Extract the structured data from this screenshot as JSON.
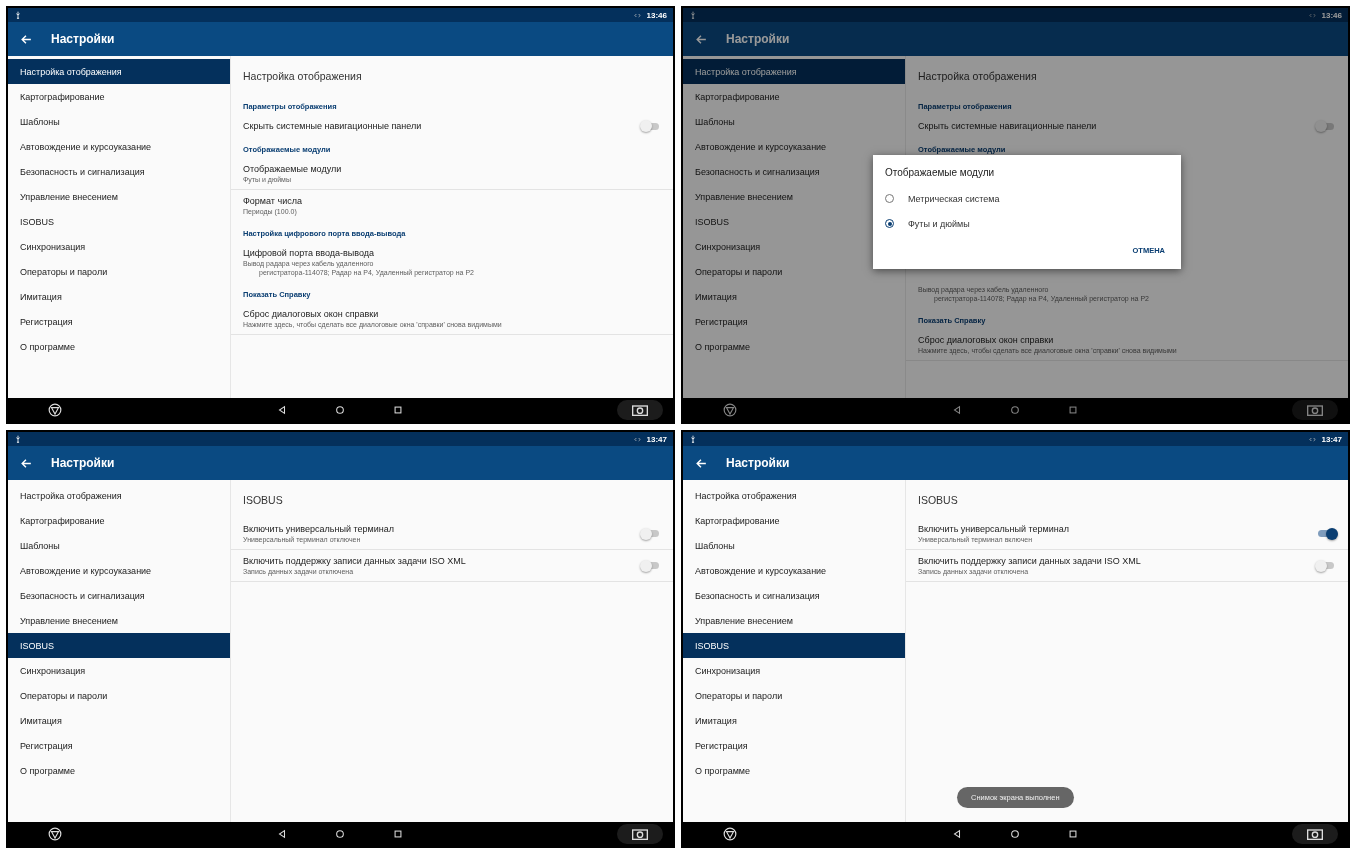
{
  "screens": [
    {
      "time": "13:46",
      "title": "Настройки",
      "sidebar": [
        {
          "label": "Настройка отображения",
          "selected": true
        },
        {
          "label": "Картографирование",
          "selected": false
        },
        {
          "label": "Шаблоны",
          "selected": false
        },
        {
          "label": "Автовождение и курсоуказание",
          "selected": false
        },
        {
          "label": "Безопасность и сигнализация",
          "selected": false
        },
        {
          "label": "Управление внесением",
          "selected": false
        },
        {
          "label": "ISOBUS",
          "selected": false
        },
        {
          "label": "Синхронизация",
          "selected": false
        },
        {
          "label": "Операторы и пароли",
          "selected": false
        },
        {
          "label": "Имитация",
          "selected": false
        },
        {
          "label": "Регистрация",
          "selected": false
        },
        {
          "label": "О программе",
          "selected": false
        }
      ],
      "heading": "Настройка отображения",
      "rows": [
        {
          "kind": "section",
          "title": "Параметры отображения"
        },
        {
          "kind": "switch",
          "title": "Скрыть системные навигационные панели",
          "on": false,
          "divider": false
        },
        {
          "kind": "section",
          "title": "Отображаемые модули"
        },
        {
          "kind": "pref",
          "title": "Отображаемые модули",
          "summary": [
            "Футы и дюймы"
          ],
          "divider": true
        },
        {
          "kind": "pref",
          "title": "Формат числа",
          "summary": [
            "Периоды (100.0)"
          ],
          "divider": false
        },
        {
          "kind": "section",
          "title": "Настройка цифрового порта ввода-вывода"
        },
        {
          "kind": "pref",
          "title": "Цифровой порта ввода-вывода",
          "summary": [
            "Вывод радара через кабель удаленного",
            "регистратора-114078; Радар на P4, Удаленный регистратор на P2"
          ],
          "divider": false
        },
        {
          "kind": "section",
          "title": "Показать Справку"
        },
        {
          "kind": "pref",
          "title": "Сброс диалоговых окон справки",
          "summary": [
            "Нажмите здесь, чтобы сделать все диалоговые окна 'справки' снова видимыми"
          ],
          "divider": true
        }
      ]
    },
    {
      "time": "13:46",
      "title": "Настройки",
      "sidebar": [
        {
          "label": "Настройка отображения",
          "selected": true
        },
        {
          "label": "Картографирование",
          "selected": false
        },
        {
          "label": "Шаблоны",
          "selected": false
        },
        {
          "label": "Автовождение и курсоуказание",
          "selected": false
        },
        {
          "label": "Безопасность и сигнализация",
          "selected": false
        },
        {
          "label": "Управление внесением",
          "selected": false
        },
        {
          "label": "ISOBUS",
          "selected": false
        },
        {
          "label": "Синхронизация",
          "selected": false
        },
        {
          "label": "Операторы и пароли",
          "selected": false
        },
        {
          "label": "Имитация",
          "selected": false
        },
        {
          "label": "Регистрация",
          "selected": false
        },
        {
          "label": "О программе",
          "selected": false
        }
      ],
      "heading": "Настройка отображения",
      "rows": [
        {
          "kind": "section",
          "title": "Параметры отображения"
        },
        {
          "kind": "switch",
          "title": "Скрыть системные навигационные панели",
          "on": false,
          "divider": false
        },
        {
          "kind": "section",
          "title": "Отображаемые модули"
        },
        {
          "kind": "covered"
        },
        {
          "kind": "pref",
          "summary": [
            "Вывод радара через кабель удаленного",
            "регистратора-114078; Радар на P4, Удаленный регистратор на P2"
          ],
          "divider": false
        },
        {
          "kind": "section",
          "title": "Показать Справку"
        },
        {
          "kind": "pref",
          "title": "Сброс диалоговых окон справки",
          "summary": [
            "Нажмите здесь, чтобы сделать все диалоговые окна 'справки' снова видимыми"
          ],
          "divider": true
        }
      ],
      "dialog": {
        "title": "Отображаемые модули",
        "options": [
          {
            "label": "Метрическая система",
            "selected": false
          },
          {
            "label": "Футы и дюймы",
            "selected": true
          }
        ],
        "button": "ОТМЕНА"
      }
    },
    {
      "time": "13:47",
      "title": "Настройки",
      "sidebar": [
        {
          "label": "Настройка отображения",
          "selected": false
        },
        {
          "label": "Картографирование",
          "selected": false
        },
        {
          "label": "Шаблоны",
          "selected": false
        },
        {
          "label": "Автовождение и курсоуказание",
          "selected": false
        },
        {
          "label": "Безопасность и сигнализация",
          "selected": false
        },
        {
          "label": "Управление внесением",
          "selected": false
        },
        {
          "label": "ISOBUS",
          "selected": true
        },
        {
          "label": "Синхронизация",
          "selected": false
        },
        {
          "label": "Операторы и пароли",
          "selected": false
        },
        {
          "label": "Имитация",
          "selected": false
        },
        {
          "label": "Регистрация",
          "selected": false
        },
        {
          "label": "О программе",
          "selected": false
        }
      ],
      "heading": "ISOBUS",
      "rows": [
        {
          "kind": "switch",
          "title": "Включить универсальный терминал",
          "summary": "Универсальный терминал отключен",
          "on": false,
          "divider": true
        },
        {
          "kind": "switch",
          "title": "Включить поддержку записи данных задачи ISO XML",
          "summary": "Запись данных задачи отключена",
          "on": false,
          "divider": true
        }
      ]
    },
    {
      "time": "13:47",
      "title": "Настройки",
      "sidebar": [
        {
          "label": "Настройка отображения",
          "selected": false
        },
        {
          "label": "Картографирование",
          "selected": false
        },
        {
          "label": "Шаблоны",
          "selected": false
        },
        {
          "label": "Автовождение и курсоуказание",
          "selected": false
        },
        {
          "label": "Безопасность и сигнализация",
          "selected": false
        },
        {
          "label": "Управление внесением",
          "selected": false
        },
        {
          "label": "ISOBUS",
          "selected": true
        },
        {
          "label": "Синхронизация",
          "selected": false
        },
        {
          "label": "Операторы и пароли",
          "selected": false
        },
        {
          "label": "Имитация",
          "selected": false
        },
        {
          "label": "Регистрация",
          "selected": false
        },
        {
          "label": "О программе",
          "selected": false
        }
      ],
      "heading": "ISOBUS",
      "rows": [
        {
          "kind": "switch",
          "title": "Включить универсальный терминал",
          "summary": "Универсальный терминал включен",
          "on": true,
          "divider": true
        },
        {
          "kind": "switch",
          "title": "Включить поддержку записи данных задачи ISO XML",
          "summary": "Запись данных задачи отключена",
          "on": false,
          "divider": true
        }
      ],
      "toast": "Снимок экрана выполнен"
    }
  ]
}
